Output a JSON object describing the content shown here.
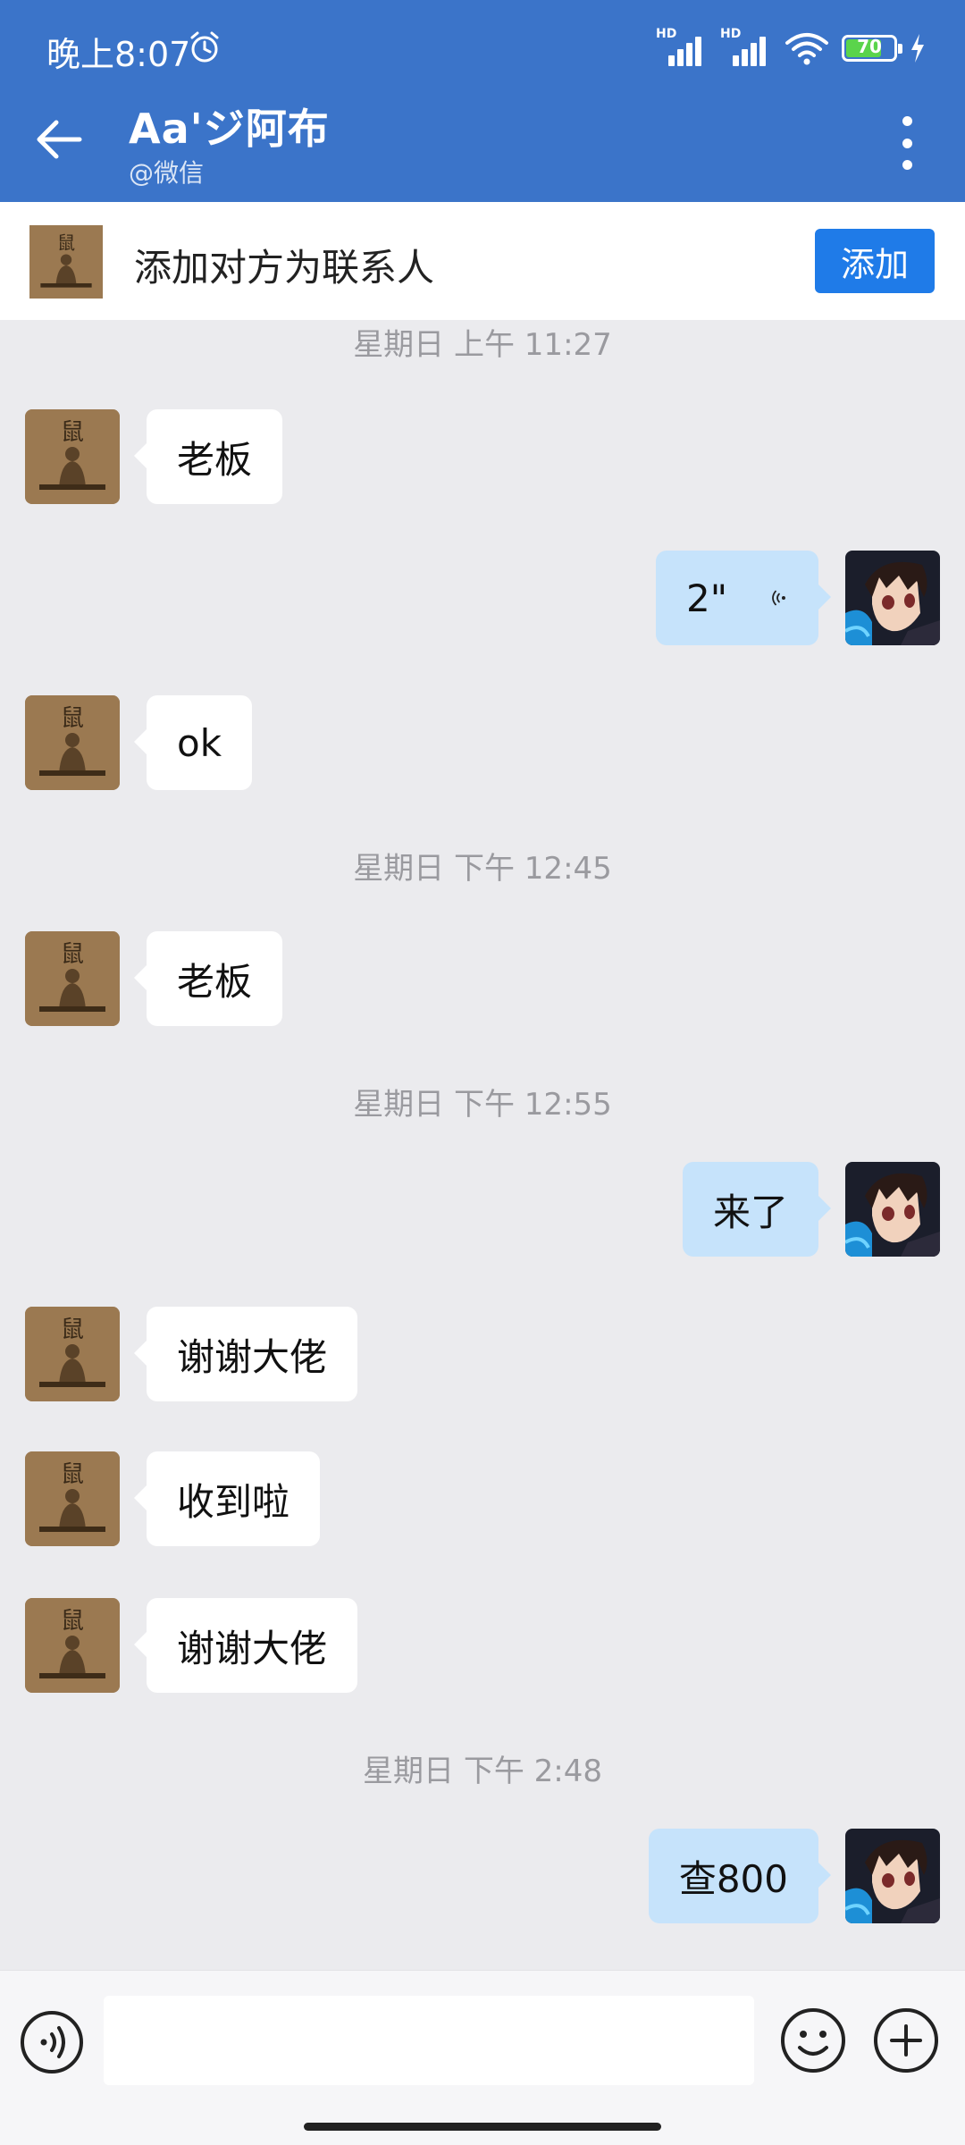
{
  "status_bar": {
    "time": "晚上8:07",
    "hd1": "HD",
    "hd2": "HD",
    "battery": "70",
    "icons": [
      "alarm-icon",
      "signal-icon",
      "signal-icon",
      "wifi-icon",
      "battery-icon",
      "charging-icon"
    ]
  },
  "header": {
    "title": "Aa'ジ阿布",
    "subtitle": "@微信",
    "icons": [
      "back-arrow-icon",
      "more-vertical-icon"
    ],
    "background_color": "#3b74c9"
  },
  "banner": {
    "text": "添加对方为联系人",
    "button_label": "添加",
    "button_color": "#1f7be8"
  },
  "chat": {
    "timestamps": [
      "星期日  上午 11:27",
      "星期日  下午 12:45",
      "星期日  下午 12:55",
      "星期日  下午 2:48"
    ],
    "messages": [
      {
        "side": "incoming",
        "text": "老板"
      },
      {
        "side": "outgoing",
        "text": "2\"",
        "type": "voice",
        "icon": "voice-wave-icon"
      },
      {
        "side": "incoming",
        "text": "ok"
      },
      {
        "side": "incoming",
        "text": "老板"
      },
      {
        "side": "outgoing",
        "text": "来了"
      },
      {
        "side": "incoming",
        "text": "谢谢大佬"
      },
      {
        "side": "incoming",
        "text": "收到啦"
      },
      {
        "side": "incoming",
        "text": "谢谢大佬"
      },
      {
        "side": "outgoing",
        "text": "查800"
      }
    ],
    "bubble_colors": {
      "incoming": "#ffffff",
      "outgoing": "#c6e3fb"
    }
  },
  "input_bar": {
    "message_input_value": "",
    "icons": [
      "voice-input-icon",
      "emoji-icon",
      "plus-icon"
    ]
  }
}
